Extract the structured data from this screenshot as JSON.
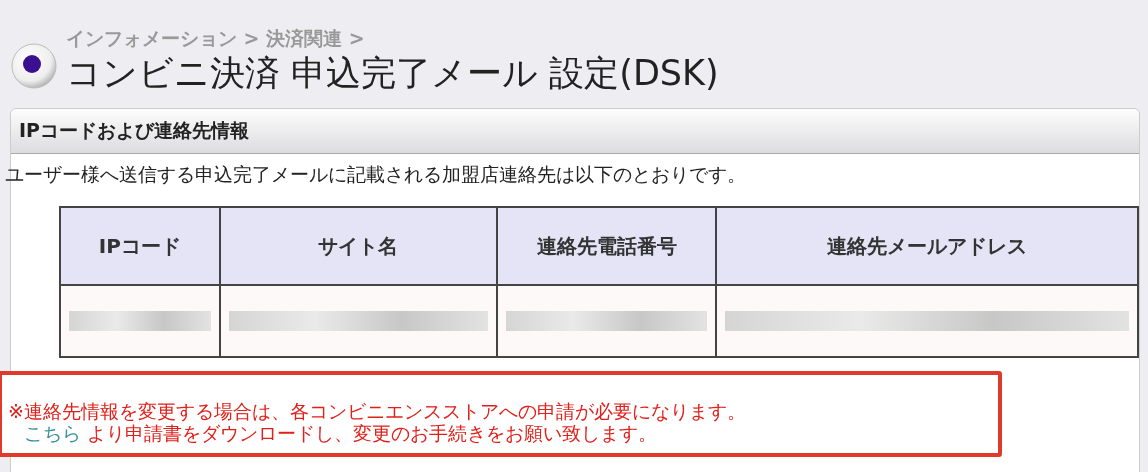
{
  "breadcrumb": "インフォメーション > 決済関連 >",
  "title": "コンビニ決済 申込完了メール 設定(DSK)",
  "panel": {
    "heading": "IPコードおよび連絡先情報",
    "description": "ユーザー様へ送信する申込完了メールに記載される加盟店連絡先は以下のとおりです。",
    "table": {
      "columns": [
        "IPコード",
        "サイト名",
        "連絡先電話番号",
        "連絡先メールアドレス"
      ],
      "rows": [
        [
          {
            "kind": "redacted"
          },
          {
            "kind": "redacted"
          },
          {
            "kind": "redacted"
          },
          {
            "kind": "redacted"
          }
        ]
      ]
    }
  },
  "notice": {
    "line_1": "※連絡先情報を変更する場合は、各コンビニエンスストアへの申請が必要になります。",
    "link": "こちら",
    "line_2": " より申請書をダウンロードし、変更のお手続きをお願い致します。"
  }
}
